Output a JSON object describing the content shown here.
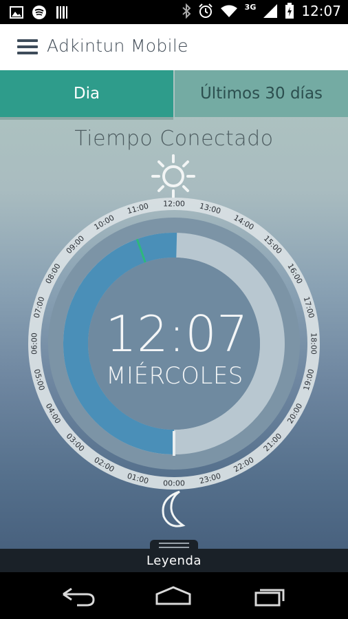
{
  "status_bar": {
    "time": "12:07",
    "network": "3G",
    "left_icons": [
      "image-icon",
      "spotify-icon",
      "barcode-icon"
    ],
    "right_icons": [
      "bluetooth-icon",
      "alarm-icon",
      "wifi-icon",
      "signal-icon",
      "battery-charging-icon"
    ]
  },
  "app_bar": {
    "title": "Adkintun Mobile",
    "menu_icon": "hamburger-menu-icon"
  },
  "tabs": [
    {
      "label": "Dia",
      "selected": true
    },
    {
      "label": "Últimos 30 días",
      "selected": false
    }
  ],
  "section": {
    "title": "Tiempo Conectado"
  },
  "dial": {
    "time": "12:07",
    "day": "MIÉRCOLES",
    "hours": [
      "00:00",
      "01:00",
      "02:00",
      "03:00",
      "04:00",
      "05:00",
      "06:00",
      "07:00",
      "08:00",
      "09:00",
      "10:00",
      "11:00",
      "12:00",
      "13:00",
      "14:00",
      "15:00",
      "16:00",
      "17:00",
      "18:00",
      "19:00",
      "20:00",
      "21:00",
      "22:00",
      "23:00"
    ],
    "connected_hours": 12.1,
    "marker_hour": 10.7,
    "top_icon": "sun-icon",
    "bottom_icon": "moon-icon",
    "colors": {
      "connected": "#4a8fb8",
      "remaining": "#b8c7d0",
      "marker": "#2eb87c",
      "tick_ring": "#d8dfe3"
    }
  },
  "legend": {
    "label": "Leyenda"
  },
  "nav_bar": {
    "buttons": [
      "back-icon",
      "home-icon",
      "recent-apps-icon"
    ]
  },
  "colors": {
    "tab_selected": "#2e9c8b",
    "tab_unselected": "#74aba3",
    "legend_bg": "#1a2128"
  }
}
